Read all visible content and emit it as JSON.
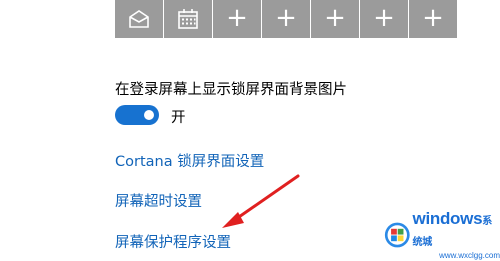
{
  "quick_status": {
    "tiles": [
      {
        "icon": "mail-icon"
      },
      {
        "icon": "calendar-icon"
      },
      {
        "icon": "plus-icon",
        "label": "+"
      },
      {
        "icon": "plus-icon",
        "label": "+"
      },
      {
        "icon": "plus-icon",
        "label": "+"
      },
      {
        "icon": "plus-icon",
        "label": "+"
      },
      {
        "icon": "plus-icon",
        "label": "+"
      }
    ]
  },
  "lock_screen_background": {
    "heading": "在登录屏幕上显示锁屏界面背景图片",
    "toggle_state": "on",
    "toggle_label": "开"
  },
  "links": {
    "cortana": "Cortana 锁屏界面设置",
    "timeout": "屏幕超时设置",
    "screensaver": "屏幕保护程序设置"
  },
  "annotation": {
    "arrow_color": "#e02020"
  },
  "watermark": {
    "brand": "windows",
    "sub": "系统城",
    "domain": "www.wxclgg.com"
  },
  "colors": {
    "accent": "#1772d0",
    "link": "#1264b8",
    "tile": "#9b9b9b"
  }
}
